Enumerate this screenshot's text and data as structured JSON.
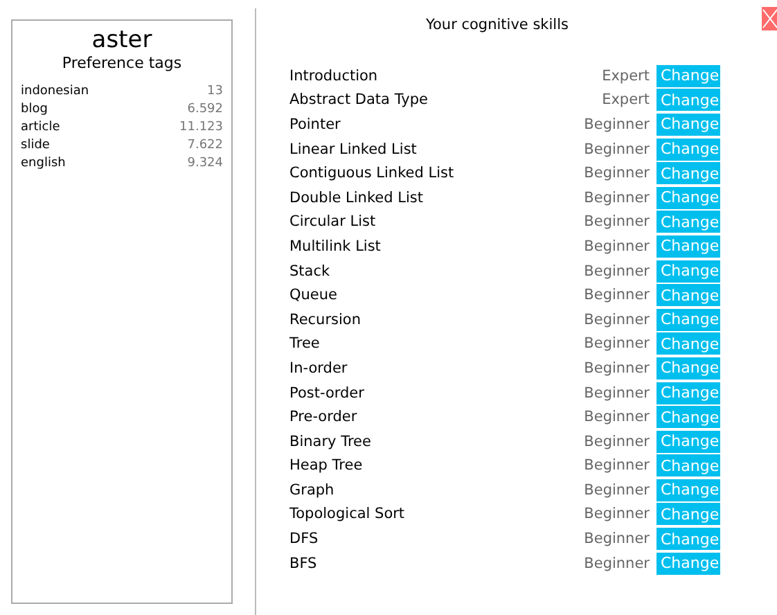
{
  "profile": {
    "name": "aster",
    "subtitle": "Preference tags",
    "tags": [
      {
        "tag": "indonesian",
        "value": "13"
      },
      {
        "tag": "blog",
        "value": "6.592"
      },
      {
        "tag": "article",
        "value": "11.123"
      },
      {
        "tag": "slide",
        "value": "7.622"
      },
      {
        "tag": "english",
        "value": "9.324"
      }
    ]
  },
  "skills": {
    "title": "Your cognitive skills",
    "rows": [
      {
        "name": "Introduction",
        "level": "Expert",
        "action": "Change"
      },
      {
        "name": "Abstract Data Type",
        "level": "Expert",
        "action": "Change"
      },
      {
        "name": "Pointer",
        "level": "Beginner",
        "action": "Change"
      },
      {
        "name": "Linear Linked List",
        "level": "Beginner",
        "action": "Change"
      },
      {
        "name": "Contiguous Linked List",
        "level": "Beginner",
        "action": "Change"
      },
      {
        "name": "Double Linked List",
        "level": "Beginner",
        "action": "Change"
      },
      {
        "name": "Circular List",
        "level": "Beginner",
        "action": "Change"
      },
      {
        "name": "Multilink List",
        "level": "Beginner",
        "action": "Change"
      },
      {
        "name": "Stack",
        "level": "Beginner",
        "action": "Change"
      },
      {
        "name": "Queue",
        "level": "Beginner",
        "action": "Change"
      },
      {
        "name": "Recursion",
        "level": "Beginner",
        "action": "Change"
      },
      {
        "name": "Tree",
        "level": "Beginner",
        "action": "Change"
      },
      {
        "name": "In-order",
        "level": "Beginner",
        "action": "Change"
      },
      {
        "name": "Post-order",
        "level": "Beginner",
        "action": "Change"
      },
      {
        "name": "Pre-order",
        "level": "Beginner",
        "action": "Change"
      },
      {
        "name": "Binary Tree",
        "level": "Beginner",
        "action": "Change"
      },
      {
        "name": "Heap Tree",
        "level": "Beginner",
        "action": "Change"
      },
      {
        "name": "Graph",
        "level": "Beginner",
        "action": "Change"
      },
      {
        "name": "Topological Sort",
        "level": "Beginner",
        "action": "Change"
      },
      {
        "name": "DFS",
        "level": "Beginner",
        "action": "Change"
      },
      {
        "name": "BFS",
        "level": "Beginner",
        "action": "Change"
      }
    ]
  }
}
